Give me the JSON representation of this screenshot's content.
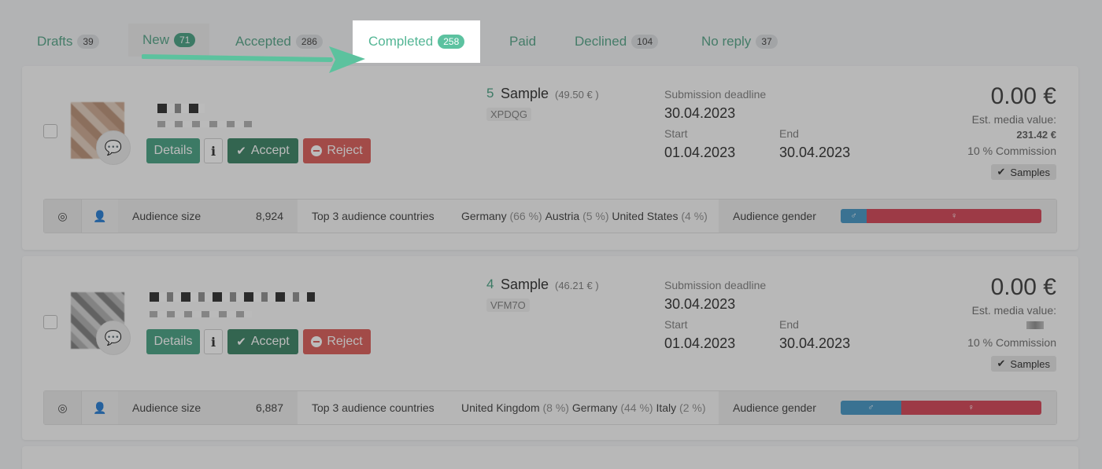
{
  "tabs": [
    {
      "label": "Drafts",
      "count": "39"
    },
    {
      "label": "New",
      "count": "71"
    },
    {
      "label": "Accepted",
      "count": "286"
    },
    {
      "label": "Completed",
      "count": "258"
    },
    {
      "label": "Paid",
      "count": ""
    },
    {
      "label": "Declined",
      "count": "104"
    },
    {
      "label": "No reply",
      "count": "37"
    }
  ],
  "buttons": {
    "details": "Details",
    "info": "i",
    "accept": "Accept",
    "reject": "Reject"
  },
  "labels": {
    "submission_deadline": "Submission deadline",
    "start": "Start",
    "end": "End",
    "est_media_value": "Est. media value:",
    "audience_size": "Audience size",
    "top3": "Top 3 audience countries",
    "audience_gender": "Audience gender",
    "samples": "Samples",
    "male": "♂",
    "female": "♀"
  },
  "cards": [
    {
      "qty": "5",
      "product": "Sample",
      "price": "(49.50 € )",
      "code": "XPDQG",
      "deadline": "30.04.2023",
      "start": "01.04.2023",
      "end": "30.04.2023",
      "amount": "0.00 €",
      "media_value": "231.42 €",
      "commission": "10 % Commission",
      "audience_size": "8,924",
      "countries": [
        {
          "name": "Germany",
          "pct": "(66 %)"
        },
        {
          "name": "Austria",
          "pct": "(5 %)"
        },
        {
          "name": "United States",
          "pct": "(4 %)"
        }
      ],
      "gender_male_fraction": 0.13
    },
    {
      "qty": "4",
      "product": "Sample",
      "price": "(46.21 € )",
      "code": "VFM7O",
      "deadline": "30.04.2023",
      "start": "01.04.2023",
      "end": "30.04.2023",
      "amount": "0.00 €",
      "media_value": "",
      "commission": "10 % Commission",
      "audience_size": "6,887",
      "countries": [
        {
          "name": "United Kingdom",
          "pct": "(8 %)"
        },
        {
          "name": "Germany",
          "pct": "(44 %)"
        },
        {
          "name": "Italy",
          "pct": "(2 %)"
        }
      ],
      "gender_male_fraction": 0.3
    }
  ]
}
